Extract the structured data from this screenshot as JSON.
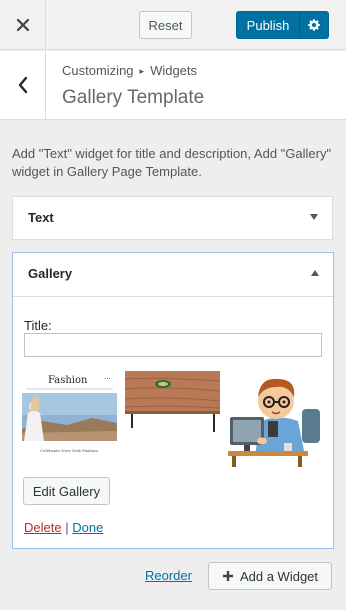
{
  "header": {
    "close_icon": "close-icon",
    "reset_label": "Reset",
    "publish_label": "Publish",
    "settings_icon": "gear-icon"
  },
  "section": {
    "back_icon": "chevron-left-icon",
    "breadcrumb_root": "Customizing",
    "breadcrumb_separator": "▸",
    "breadcrumb_current": "Widgets",
    "title": "Gallery Template"
  },
  "description": "Add \"Text\" widget for title and description, Add \"Gallery\" widget in Gallery Page Template.",
  "widgets": [
    {
      "title": "Text",
      "state": "collapsed",
      "toggle_icon": "arrow-down-icon"
    },
    {
      "title": "Gallery",
      "state": "expanded",
      "toggle_icon": "arrow-up-icon",
      "title_field_label": "Title:",
      "title_field_value": "",
      "images": [
        {
          "name": "fashion-image",
          "caption_title": "Fashion",
          "caption_text": "Celebrate New York Fashion"
        },
        {
          "name": "table-image"
        },
        {
          "name": "programmer-image"
        }
      ],
      "edit_gallery_label": "Edit Gallery",
      "delete_label": "Delete",
      "separator": "|",
      "done_label": "Done"
    }
  ],
  "footer": {
    "reorder_label": "Reorder",
    "add_widget_label": "Add a Widget",
    "add_icon": "plus-icon"
  },
  "colors": {
    "primary": "#0071a1",
    "link": "#0073aa",
    "delete": "#b32d2e",
    "background": "#eeeeee"
  }
}
